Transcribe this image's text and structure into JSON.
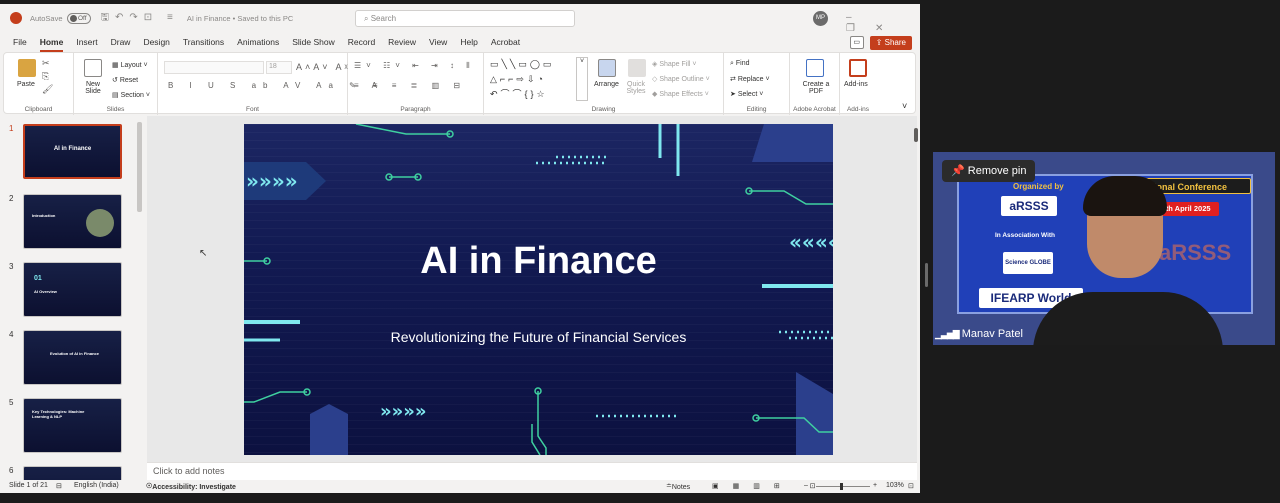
{
  "titlebar": {
    "autosave_label": "AutoSave",
    "toggle_state": "Off",
    "doc_title": "AI in Finance • Saved to this PC",
    "search_placeholder": "Search",
    "avatar": "MP"
  },
  "menu": {
    "tabs": [
      "File",
      "Home",
      "Insert",
      "Draw",
      "Design",
      "Transitions",
      "Animations",
      "Slide Show",
      "Record",
      "Review",
      "View",
      "Help",
      "Acrobat"
    ],
    "active": "Home",
    "share": "Share"
  },
  "ribbon": {
    "clipboard": {
      "paste": "Paste",
      "label": "Clipboard"
    },
    "slides": {
      "new_slide": "New Slide",
      "layout": "Layout",
      "reset": "Reset",
      "section": "Section",
      "label": "Slides"
    },
    "font": {
      "name": "",
      "size": "18",
      "label": "Font"
    },
    "paragraph": {
      "label": "Paragraph"
    },
    "drawing": {
      "arrange": "Arrange",
      "quick_styles": "Quick Styles",
      "shape_fill": "Shape Fill",
      "shape_outline": "Shape Outline",
      "shape_effects": "Shape Effects",
      "label": "Drawing"
    },
    "editing": {
      "find": "Find",
      "replace": "Replace",
      "select": "Select",
      "label": "Editing"
    },
    "acrobat": {
      "create_pdf": "Create a PDF",
      "label": "Adobe Acrobat"
    },
    "addins": {
      "addins": "Add-ins",
      "label": "Add-ins"
    }
  },
  "thumbnails": [
    {
      "num": "1",
      "title": "AI in Finance"
    },
    {
      "num": "2",
      "title": "Introduction"
    },
    {
      "num": "3",
      "title": "AI Overview",
      "badge": "01"
    },
    {
      "num": "4",
      "title": "Evolution of AI in Finance"
    },
    {
      "num": "5",
      "title": "Key Technologies: Machine Learning & NLP"
    },
    {
      "num": "6",
      "title": ""
    }
  ],
  "slide": {
    "title": "AI in Finance",
    "subtitle": "Revolutionizing the Future of Financial Services"
  },
  "notes": {
    "placeholder": "Click to add notes"
  },
  "status": {
    "slide_info": "Slide 1 of 21",
    "language": "English (India)",
    "accessibility": "Accessibility: Investigate",
    "notes": "Notes",
    "zoom": "103%"
  },
  "video": {
    "pin_label": "Remove pin",
    "participant": "Manav Patel",
    "organized_by": "Organized by",
    "conference": "rnational Conference",
    "date": "05th April 2025",
    "assoc": "In Association With",
    "org1": "aRSSS",
    "org2": "Science GLOBE",
    "org3": "IFEARP World"
  }
}
